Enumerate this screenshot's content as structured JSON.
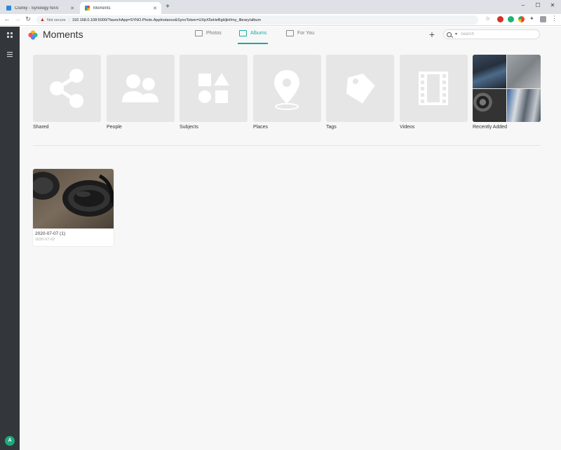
{
  "browser": {
    "tabs": [
      {
        "title": "Clunky - Synology NAS",
        "active": false,
        "favicon_color": "#2e86de"
      },
      {
        "title": "Moments",
        "active": true,
        "favicon_color": "#f4b400"
      }
    ],
    "address": {
      "security_label": "Not secure",
      "url": "192.168.0.108:5000/?launchApp=SYNO.Photo.AppInstance&SynoToken=UXpX5eHeBgHjk#/my_library/album"
    },
    "window_controls": {
      "minimize": "–",
      "restore": "☐",
      "close": "✕"
    },
    "new_tab": "+"
  },
  "dsm": {
    "main_menu_icon": "grid-icon",
    "taskbar_icon": "list-icon",
    "user_badge": "A"
  },
  "app": {
    "title": "Moments",
    "nav_tabs": [
      {
        "label": "Photos",
        "icon": "photos-icon",
        "active": false
      },
      {
        "label": "Albums",
        "icon": "albums-icon",
        "active": true
      },
      {
        "label": "For You",
        "icon": "gift-icon",
        "active": false
      }
    ],
    "add_label": "+",
    "search": {
      "placeholder": "Search",
      "value": ""
    },
    "accent_color": "#1ca9a0"
  },
  "categories": [
    {
      "label": "Shared",
      "icon": "share-icon"
    },
    {
      "label": "People",
      "icon": "people-icon"
    },
    {
      "label": "Subjects",
      "icon": "shapes-icon"
    },
    {
      "label": "Places",
      "icon": "location-pin-icon"
    },
    {
      "label": "Tags",
      "icon": "tag-icon"
    },
    {
      "label": "Videos",
      "icon": "film-icon"
    },
    {
      "label": "Recently Added",
      "icon": "photo-mosaic"
    }
  ],
  "albums": [
    {
      "title": "2020-07-07 (1)",
      "date": "2020-07-02"
    }
  ]
}
